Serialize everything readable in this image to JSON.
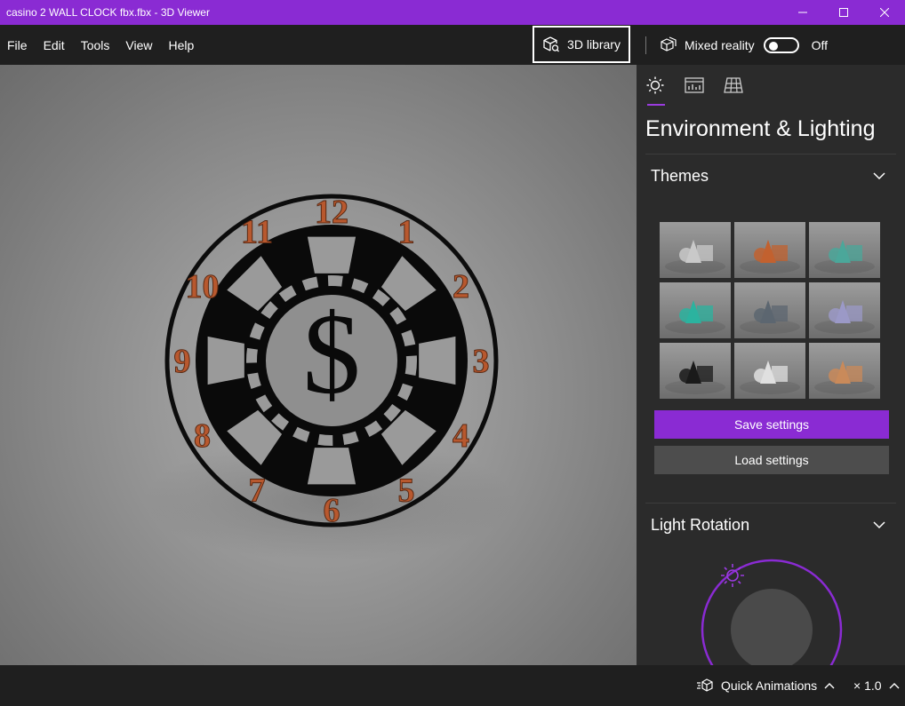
{
  "window": {
    "title": "casino 2 WALL CLOCK fbx.fbx - 3D Viewer",
    "controls": [
      "minimize",
      "maximize",
      "close"
    ],
    "accent": "#8a2bd3"
  },
  "menu": {
    "items": [
      {
        "label": "File"
      },
      {
        "label": "Edit"
      },
      {
        "label": "Tools"
      },
      {
        "label": "View"
      },
      {
        "label": "Help"
      }
    ],
    "library_label": "3D library",
    "mixed_reality_label": "Mixed reality",
    "mixed_reality_state": "Off"
  },
  "viewport": {
    "model": {
      "numbers": [
        "12",
        "1",
        "2",
        "3",
        "4",
        "5",
        "6",
        "7",
        "8",
        "9",
        "10",
        "11"
      ],
      "center_symbol": "$",
      "number_color": "#b8582e"
    }
  },
  "panel": {
    "tabs": [
      "sun-icon",
      "stats-icon",
      "grid-icon"
    ],
    "active_tab": 0,
    "title": "Environment & Lighting",
    "themes": {
      "title": "Themes",
      "items": [
        {
          "name": "theme-1",
          "color": "#c9c9c9"
        },
        {
          "name": "theme-2",
          "color": "#c2612f"
        },
        {
          "name": "theme-3",
          "color": "#4ba79a"
        },
        {
          "name": "theme-4",
          "color": "#2bb39f"
        },
        {
          "name": "theme-5",
          "color": "#5c6670"
        },
        {
          "name": "theme-6",
          "color": "#9b99c7"
        },
        {
          "name": "theme-7",
          "color": "#1a1a1a"
        },
        {
          "name": "theme-8",
          "color": "#e0e0e0"
        },
        {
          "name": "theme-9",
          "color": "#c98a5a"
        }
      ]
    },
    "save_label": "Save settings",
    "load_label": "Load settings",
    "light_rotation": {
      "title": "Light Rotation"
    }
  },
  "bottom": {
    "animations_label": "Quick Animations",
    "speed_label": "× 1.0"
  }
}
